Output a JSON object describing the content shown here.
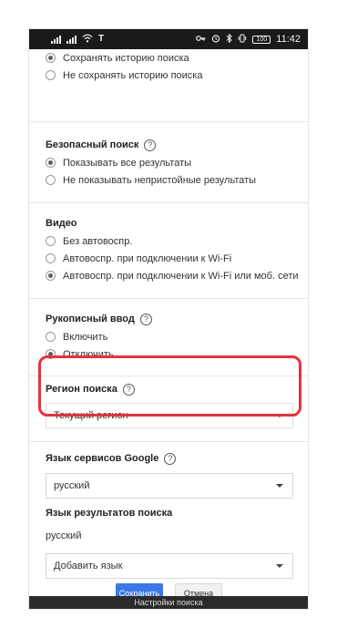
{
  "status_bar": {
    "time": "11:42",
    "battery": "100",
    "left_icons": [
      "signal-icon",
      "signal-icon",
      "wifi-icon",
      "t-icon"
    ],
    "right_icons": [
      "key-icon",
      "alarm-icon",
      "bluetooth-icon",
      "vibrate-icon"
    ]
  },
  "history": {
    "options": [
      {
        "label": "Сохранять историю поиска",
        "checked": true
      },
      {
        "label": "Не сохранять историю поиска",
        "checked": false
      }
    ]
  },
  "safe_search": {
    "title": "Безопасный поиск",
    "options": [
      {
        "label": "Показывать все результаты",
        "checked": true
      },
      {
        "label": "Не показывать непристойные результаты",
        "checked": false
      }
    ]
  },
  "video": {
    "title": "Видео",
    "options": [
      {
        "label": "Без автовоспр.",
        "checked": false
      },
      {
        "label": "Автовоспр. при подключении к Wi-Fi",
        "checked": false
      },
      {
        "label": "Автовоспр. при подключении к Wi-Fi или моб. сети",
        "checked": true
      }
    ]
  },
  "handwriting": {
    "title": "Рукописный ввод",
    "options": [
      {
        "label": "Включить",
        "checked": false
      },
      {
        "label": "Отключить",
        "checked": true
      }
    ]
  },
  "region": {
    "title": "Регион поиска",
    "selected": "Текущий регион"
  },
  "google_lang": {
    "title": "Язык сервисов Google",
    "selected": "русский"
  },
  "results_lang": {
    "title": "Язык результатов поиска",
    "current": "русский",
    "add_placeholder": "Добавить язык"
  },
  "buttons": {
    "save": "Сохранить",
    "cancel": "Отмена"
  },
  "bottom_bar": "Настройки поиска",
  "colors": {
    "highlight": "#e5323b",
    "primary_button": "#3b78e7",
    "status_bar": "#1a1a1a"
  }
}
